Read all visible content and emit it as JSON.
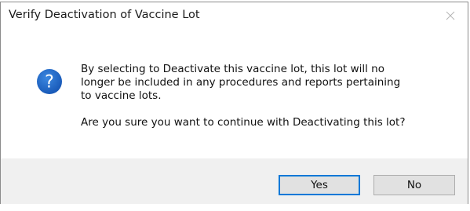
{
  "dialog": {
    "title": "Verify Deactivation of Vaccine Lot",
    "close_icon": "close-icon",
    "question_icon": "question-icon",
    "message_line1": "By selecting to Deactivate this vaccine lot, this lot will no",
    "message_line2": "longer be included in any procedures and reports pertaining",
    "message_line3": "to vaccine lots.",
    "confirm_question": "Are you sure you want to continue with Deactivating this lot?",
    "buttons": {
      "yes_label": "Yes",
      "no_label": "No"
    }
  },
  "colors": {
    "icon_blue": "#1e67c6",
    "default_button_border": "#0078d7",
    "footer_bg": "#f0f0f0"
  }
}
